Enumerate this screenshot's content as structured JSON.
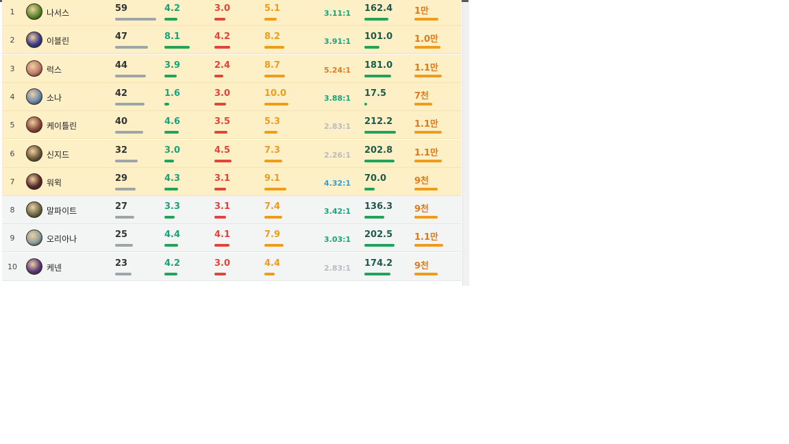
{
  "rows": [
    {
      "rank": "1",
      "name": "나서스",
      "games": "59",
      "games_frac": 0.96,
      "kills": "4.2",
      "kills_frac": 0.52,
      "deaths": "3.0",
      "deaths_frac": 0.5,
      "assists": "5.1",
      "assists_frac": 0.51,
      "kda": "3.11:1",
      "kda_color": "#1aa37a",
      "cs": "162.4",
      "cs_frac": 0.77,
      "gold": "1만",
      "gold_frac": 0.83
    },
    {
      "rank": "2",
      "name": "이블린",
      "games": "47",
      "games_frac": 0.77,
      "kills": "8.1",
      "kills_frac": 1.0,
      "deaths": "4.2",
      "deaths_frac": 0.72,
      "assists": "8.2",
      "assists_frac": 0.82,
      "kda": "3.91:1",
      "kda_color": "#1aa37a",
      "cs": "101.0",
      "cs_frac": 0.48,
      "gold": "1.0만",
      "gold_frac": 0.91
    },
    {
      "rank": "3",
      "name": "럭스",
      "games": "44",
      "games_frac": 0.72,
      "kills": "3.9",
      "kills_frac": 0.48,
      "deaths": "2.4",
      "deaths_frac": 0.41,
      "assists": "8.7",
      "assists_frac": 0.87,
      "kda": "5.24:1",
      "kda_color": "#e07a1a",
      "cs": "181.0",
      "cs_frac": 0.85,
      "gold": "1.1만",
      "gold_frac": 0.95
    },
    {
      "rank": "4",
      "name": "소나",
      "games": "42",
      "games_frac": 0.7,
      "kills": "1.6",
      "kills_frac": 0.2,
      "deaths": "3.0",
      "deaths_frac": 0.52,
      "assists": "10.0",
      "assists_frac": 1.0,
      "kda": "3.88:1",
      "kda_color": "#1aa37a",
      "cs": "17.5",
      "cs_frac": 0.08,
      "gold": "7천",
      "gold_frac": 0.62
    },
    {
      "rank": "5",
      "name": "케이틀린",
      "games": "40",
      "games_frac": 0.66,
      "kills": "4.6",
      "kills_frac": 0.57,
      "deaths": "3.5",
      "deaths_frac": 0.6,
      "assists": "5.3",
      "assists_frac": 0.53,
      "kda": "2.83:1",
      "kda_color": "#b7bcbf",
      "cs": "212.2",
      "cs_frac": 1.0,
      "gold": "1.1만",
      "gold_frac": 0.95
    },
    {
      "rank": "6",
      "name": "신지드",
      "games": "32",
      "games_frac": 0.54,
      "kills": "3.0",
      "kills_frac": 0.37,
      "deaths": "4.5",
      "deaths_frac": 0.77,
      "assists": "7.3",
      "assists_frac": 0.73,
      "kda": "2.26:1",
      "kda_color": "#b7bcbf",
      "cs": "202.8",
      "cs_frac": 0.96,
      "gold": "1.1만",
      "gold_frac": 0.95
    },
    {
      "rank": "7",
      "name": "워윅",
      "games": "29",
      "games_frac": 0.48,
      "kills": "4.3",
      "kills_frac": 0.53,
      "deaths": "3.1",
      "deaths_frac": 0.53,
      "assists": "9.1",
      "assists_frac": 0.91,
      "kda": "4.32:1",
      "kda_color": "#3c9ad6",
      "cs": "70.0",
      "cs_frac": 0.33,
      "gold": "9천",
      "gold_frac": 0.81
    },
    {
      "rank": "8",
      "name": "말파이트",
      "games": "27",
      "games_frac": 0.45,
      "kills": "3.3",
      "kills_frac": 0.41,
      "deaths": "3.1",
      "deaths_frac": 0.53,
      "assists": "7.4",
      "assists_frac": 0.74,
      "kda": "3.42:1",
      "kda_color": "#1aa37a",
      "cs": "136.3",
      "cs_frac": 0.64,
      "gold": "9천",
      "gold_frac": 0.81
    },
    {
      "rank": "9",
      "name": "오리아나",
      "games": "25",
      "games_frac": 0.42,
      "kills": "4.4",
      "kills_frac": 0.54,
      "deaths": "4.1",
      "deaths_frac": 0.7,
      "assists": "7.9",
      "assists_frac": 0.79,
      "kda": "3.03:1",
      "kda_color": "#1aa37a",
      "cs": "202.5",
      "cs_frac": 0.95,
      "gold": "1.1만",
      "gold_frac": 1.0
    },
    {
      "rank": "10",
      "name": "케넨",
      "games": "23",
      "games_frac": 0.39,
      "kills": "4.2",
      "kills_frac": 0.52,
      "deaths": "3.0",
      "deaths_frac": 0.52,
      "assists": "4.4",
      "assists_frac": 0.44,
      "kda": "2.83:1",
      "kda_color": "#b7bcbf",
      "cs": "174.2",
      "cs_frac": 0.82,
      "gold": "9천",
      "gold_frac": 0.81
    }
  ],
  "highlight_count": 7,
  "colors": {
    "highlight_row_bg": "#fdf0c7",
    "normal_row_bg": "#f3f5f5",
    "kills": "#22a35a",
    "deaths": "#e0453a",
    "assists": "#ef9c1a",
    "games": "#9ea5a8"
  },
  "avatar_colors": [
    "#5a8a2a",
    "#3a3a8a",
    "#c07a6a",
    "#6a8ab0",
    "#8a4a3a",
    "#6a5a3a",
    "#5a2a2a",
    "#6a6a4a",
    "#8aa0a0",
    "#5a3a7a"
  ]
}
